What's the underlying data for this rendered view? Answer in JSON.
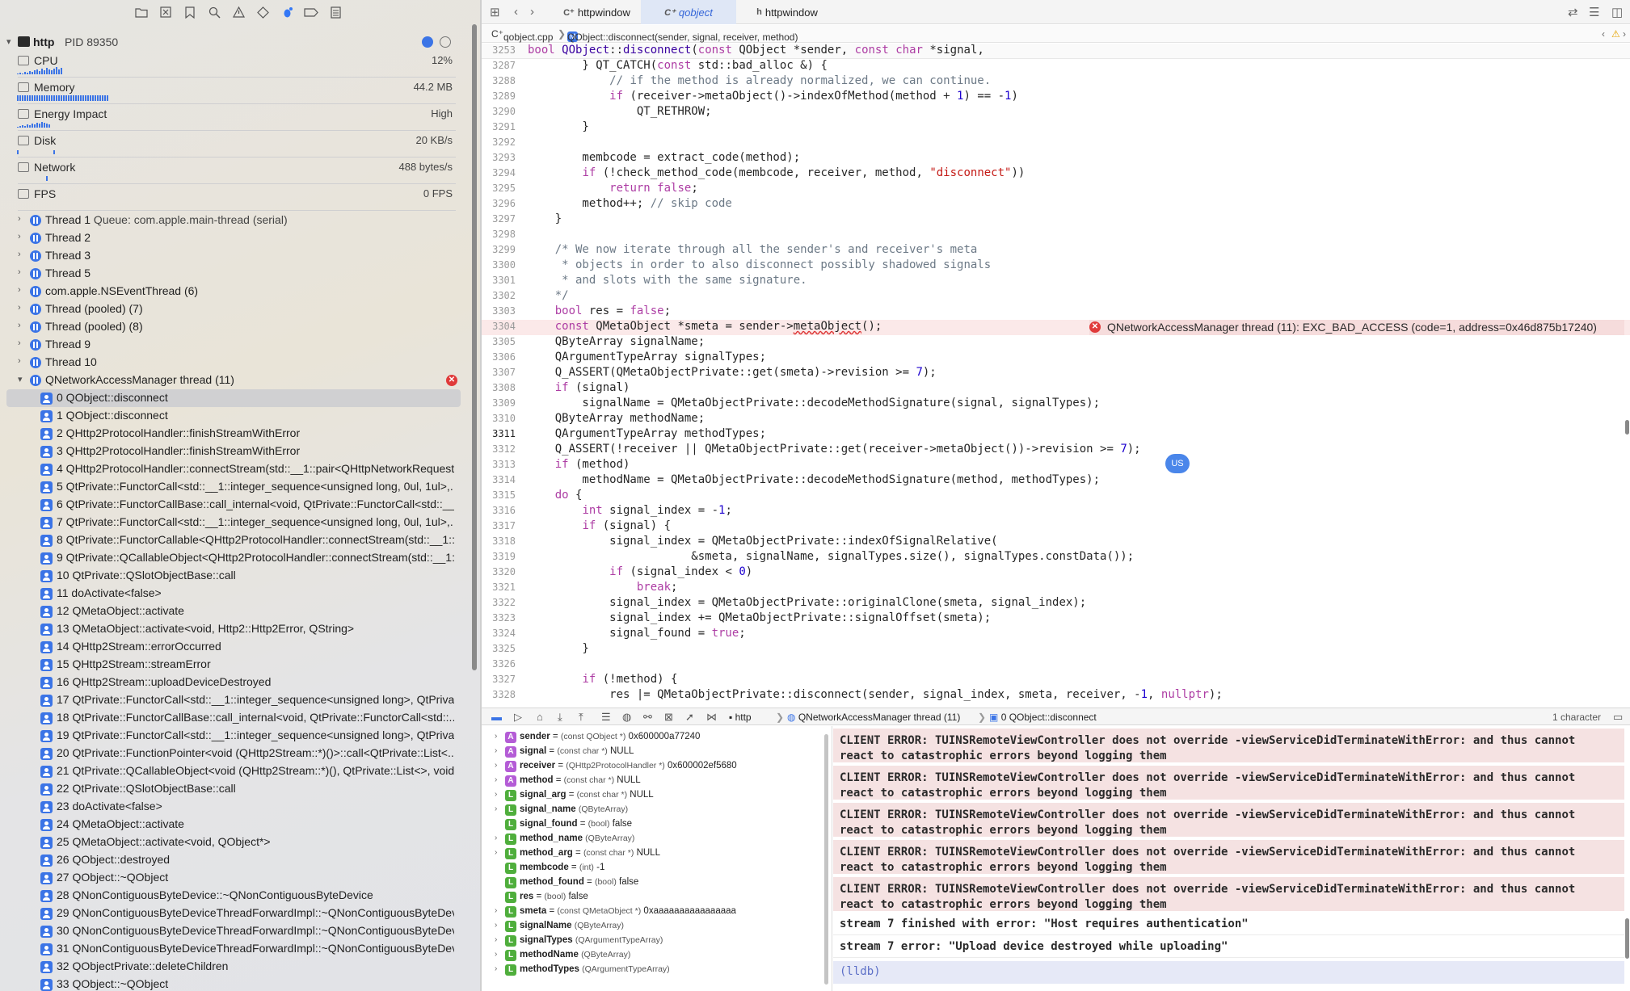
{
  "nav": {
    "toolbar_icons": [
      "folder-icon",
      "source-control-icon",
      "bookmark-icon",
      "find-icon",
      "issue-icon",
      "test-icon",
      "debug-icon",
      "breakpoint-icon",
      "report-icon"
    ]
  },
  "process": {
    "name": "http",
    "pid": "PID 89350"
  },
  "gauges": [
    {
      "name": "CPU",
      "value": "12%"
    },
    {
      "name": "Memory",
      "value": "44.2 MB"
    },
    {
      "name": "Energy Impact",
      "value": "High"
    },
    {
      "name": "Disk",
      "value": "20 KB/s"
    },
    {
      "name": "Network",
      "value": "488 bytes/s"
    },
    {
      "name": "FPS",
      "value": "0 FPS"
    }
  ],
  "threads": [
    {
      "label": "Thread 1",
      "queue": "Queue: com.apple.main-thread (serial)"
    },
    {
      "label": "Thread 2",
      "queue": ""
    },
    {
      "label": "Thread 3",
      "queue": ""
    },
    {
      "label": "Thread 5",
      "queue": ""
    },
    {
      "label": "com.apple.NSEventThread (6)",
      "queue": ""
    },
    {
      "label": "Thread (pooled) (7)",
      "queue": ""
    },
    {
      "label": "Thread (pooled) (8)",
      "queue": ""
    },
    {
      "label": "Thread 9",
      "queue": ""
    },
    {
      "label": "Thread 10",
      "queue": ""
    },
    {
      "label": "QNetworkAccessManager thread (11)",
      "queue": ""
    }
  ],
  "frames": [
    "0 QObject::disconnect",
    "1 QObject::disconnect",
    "2 QHttp2ProtocolHandler::finishStreamWithError",
    "3 QHttp2ProtocolHandler::finishStreamWithError",
    "4 QHttp2ProtocolHandler::connectStream(std::__1::pair<QHttpNetworkRequest...",
    "5 QtPrivate::FunctorCall<std::__1::integer_sequence<unsigned long, 0ul, 1ul>,...",
    "6 QtPrivate::FunctorCallBase::call_internal<void, QtPrivate::FunctorCall<std::__...",
    "7 QtPrivate::FunctorCall<std::__1::integer_sequence<unsigned long, 0ul, 1ul>,...",
    "8 QtPrivate::FunctorCallable<QHttp2ProtocolHandler::connectStream(std::__1::...",
    "9 QtPrivate::QCallableObject<QHttp2ProtocolHandler::connectStream(std::__1:...",
    "10 QtPrivate::QSlotObjectBase::call",
    "11 doActivate<false>",
    "12 QMetaObject::activate",
    "13 QMetaObject::activate<void, Http2::Http2Error, QString>",
    "14 QHttp2Stream::errorOccurred",
    "15 QHttp2Stream::streamError",
    "16 QHttp2Stream::uploadDeviceDestroyed",
    "17 QtPrivate::FunctorCall<std::__1::integer_sequence<unsigned long>, QtPrivat...",
    "18 QtPrivate::FunctorCallBase::call_internal<void, QtPrivate::FunctorCall<std::...",
    "19 QtPrivate::FunctorCall<std::__1::integer_sequence<unsigned long>, QtPrivat...",
    "20 QtPrivate::FunctionPointer<void (QHttp2Stream::*)()>::call<QtPrivate::List<...",
    "21 QtPrivate::QCallableObject<void (QHttp2Stream::*)(), QtPrivate::List<>, void...",
    "22 QtPrivate::QSlotObjectBase::call",
    "23 doActivate<false>",
    "24 QMetaObject::activate",
    "25 QMetaObject::activate<void, QObject*>",
    "26 QObject::destroyed",
    "27 QObject::~QObject",
    "28 QNonContiguousByteDevice::~QNonContiguousByteDevice",
    "29 QNonContiguousByteDeviceThreadForwardImpl::~QNonContiguousByteDev...",
    "30 QNonContiguousByteDeviceThreadForwardImpl::~QNonContiguousByteDev...",
    "31 QNonContiguousByteDeviceThreadForwardImpl::~QNonContiguousByteDevi...",
    "32 QObjectPrivate::deleteChildren",
    "33 QObject::~QObject"
  ],
  "tabs": [
    {
      "icon": "C⁺",
      "label": "httpwindow"
    },
    {
      "icon": "C⁺",
      "label": "qobject"
    },
    {
      "icon": "h",
      "label": "httpwindow"
    }
  ],
  "jumpbar": {
    "file": "qobject.cpp",
    "symbol": "QObject::disconnect(sender, signal, receiver, method)",
    "sep": "❯"
  },
  "code": {
    "sticky": {
      "num": "3253",
      "html": "<span class=\"k\">bool</span> <span class=\"t\">QObject</span>::<span class=\"t\">disconnect</span>(<span class=\"k\">const</span> QObject *sender, <span class=\"k\">const</span> <span class=\"k\">char</span> *signal,"
    },
    "lines": [
      {
        "num": "3287",
        "html": "        } QT_CATCH(<span class=\"k\">const</span> std::bad_alloc &amp;) {"
      },
      {
        "num": "3288",
        "html": "            <span class=\"c\">// if the method is already normalized, we can continue.</span>"
      },
      {
        "num": "3289",
        "html": "            <span class=\"k\">if</span> (receiver-&gt;metaObject()-&gt;indexOfMethod(method + <span class=\"n\">1</span>) == -<span class=\"n\">1</span>)"
      },
      {
        "num": "3290",
        "html": "                QT_RETHROW;"
      },
      {
        "num": "3291",
        "html": "        }"
      },
      {
        "num": "3292",
        "html": ""
      },
      {
        "num": "3293",
        "html": "        membcode = extract_code(method);"
      },
      {
        "num": "3294",
        "html": "        <span class=\"k\">if</span> (!check_method_code(membcode, receiver, method, <span class=\"s\">\"disconnect\"</span>))"
      },
      {
        "num": "3295",
        "html": "            <span class=\"k\">return</span> <span class=\"k\">false</span>;"
      },
      {
        "num": "3296",
        "html": "        method++; <span class=\"c\">// skip code</span>"
      },
      {
        "num": "3297",
        "html": "    }"
      },
      {
        "num": "3298",
        "html": ""
      },
      {
        "num": "3299",
        "html": "    <span class=\"c\">/* We now iterate through all the sender's and receiver's meta</span>"
      },
      {
        "num": "3300",
        "html": "<span class=\"c\">     * objects in order to also disconnect possibly shadowed signals</span>"
      },
      {
        "num": "3301",
        "html": "<span class=\"c\">     * and slots with the same signature.</span>"
      },
      {
        "num": "3302",
        "html": "<span class=\"c\">    */</span>"
      },
      {
        "num": "3303",
        "html": "    <span class=\"k\">bool</span> res = <span class=\"k\">false</span>;"
      },
      {
        "num": "3304",
        "html": "    <span class=\"k\">const</span> QMetaObject *smeta = sender-&gt;<span style=\"text-decoration: underline wavy #d33;\">metaObject</span>();",
        "error": true
      },
      {
        "num": "3305",
        "html": "    QByteArray signalName;"
      },
      {
        "num": "3306",
        "html": "    QArgumentTypeArray signalTypes;"
      },
      {
        "num": "3307",
        "html": "    Q_ASSERT(QMetaObjectPrivate::get(smeta)-&gt;revision &gt;= <span class=\"n\">7</span>);"
      },
      {
        "num": "3308",
        "html": "    <span class=\"k\">if</span> (signal)"
      },
      {
        "num": "3309",
        "html": "        signalName = QMetaObjectPrivate::decodeMethodSignature(signal, signalTypes);"
      },
      {
        "num": "3310",
        "html": "    QByteArray methodName;"
      },
      {
        "num": "3311",
        "html": "    QArgumentTypeArray methodTypes;",
        "current": true
      },
      {
        "num": "3312",
        "html": "    Q_ASSERT(!receiver || QMetaObjectPrivate::get(receiver-&gt;metaObject())-&gt;revision &gt;= <span class=\"n\">7</span>);"
      },
      {
        "num": "3313",
        "html": "    <span class=\"k\">if</span> (method)"
      },
      {
        "num": "3314",
        "html": "        methodName = QMetaObjectPrivate::decodeMethodSignature(method, methodTypes);"
      },
      {
        "num": "3315",
        "html": "    <span class=\"k\">do</span> {"
      },
      {
        "num": "3316",
        "html": "        <span class=\"k\">int</span> signal_index = -<span class=\"n\">1</span>;"
      },
      {
        "num": "3317",
        "html": "        <span class=\"k\">if</span> (signal) {"
      },
      {
        "num": "3318",
        "html": "            signal_index = QMetaObjectPrivate::indexOfSignalRelative("
      },
      {
        "num": "3319",
        "html": "                        &amp;smeta, signalName, signalTypes.size(), signalTypes.constData());"
      },
      {
        "num": "3320",
        "html": "            <span class=\"k\">if</span> (signal_index &lt; <span class=\"n\">0</span>)"
      },
      {
        "num": "3321",
        "html": "                <span class=\"k\">break</span>;"
      },
      {
        "num": "3322",
        "html": "            signal_index = QMetaObjectPrivate::originalClone(smeta, signal_index);"
      },
      {
        "num": "3323",
        "html": "            signal_index += QMetaObjectPrivate::signalOffset(smeta);"
      },
      {
        "num": "3324",
        "html": "            signal_found = <span class=\"k\">true</span>;"
      },
      {
        "num": "3325",
        "html": "        }"
      },
      {
        "num": "3326",
        "html": ""
      },
      {
        "num": "3327",
        "html": "        <span class=\"k\">if</span> (!method) {"
      },
      {
        "num": "3328",
        "html": "            res |= QMetaObjectPrivate::disconnect(sender, signal_index, smeta, receiver, -<span class=\"n\">1</span>, <span class=\"k\">nullptr</span>);"
      }
    ],
    "error_message": "QNetworkAccessManager thread (11): EXC_BAD_ACCESS (code=1, address=0x46d875b17240)",
    "bubble": "US"
  },
  "debugbar": {
    "process": "http",
    "thread": "QNetworkAccessManager thread (11)",
    "frame": "0 QObject::disconnect",
    "selection": "1 character"
  },
  "variables": [
    {
      "kind": "A",
      "expand": true,
      "name": "sender",
      "rest": " = ",
      "type": "(const QObject *)",
      "value": " 0x600000a77240"
    },
    {
      "kind": "A",
      "expand": true,
      "name": "signal",
      "rest": " = ",
      "type": "(const char *)",
      "value": " NULL"
    },
    {
      "kind": "A",
      "expand": true,
      "name": "receiver",
      "rest": " = ",
      "type": "(QHttp2ProtocolHandler *)",
      "value": " 0x600002ef5680"
    },
    {
      "kind": "A",
      "expand": true,
      "name": "method",
      "rest": " = ",
      "type": "(const char *)",
      "value": " NULL"
    },
    {
      "kind": "L",
      "expand": true,
      "name": "signal_arg",
      "rest": " = ",
      "type": "(const char *)",
      "value": " NULL"
    },
    {
      "kind": "L",
      "expand": true,
      "name": "signal_name",
      "rest": " ",
      "type": "(QByteArray)",
      "value": ""
    },
    {
      "kind": "L",
      "expand": false,
      "name": "signal_found",
      "rest": " = ",
      "type": "(bool)",
      "value": " false"
    },
    {
      "kind": "L",
      "expand": true,
      "name": "method_name",
      "rest": " ",
      "type": "(QByteArray)",
      "value": ""
    },
    {
      "kind": "L",
      "expand": true,
      "name": "method_arg",
      "rest": " = ",
      "type": "(const char *)",
      "value": " NULL"
    },
    {
      "kind": "L",
      "expand": false,
      "name": "membcode",
      "rest": " = ",
      "type": "(int)",
      "value": " -1"
    },
    {
      "kind": "L",
      "expand": false,
      "name": "method_found",
      "rest": " = ",
      "type": "(bool)",
      "value": " false"
    },
    {
      "kind": "L",
      "expand": false,
      "name": "res",
      "rest": " = ",
      "type": "(bool)",
      "value": " false"
    },
    {
      "kind": "L",
      "expand": true,
      "name": "smeta",
      "rest": " = ",
      "type": "(const QMetaObject *)",
      "value": " 0xaaaaaaaaaaaaaaaa"
    },
    {
      "kind": "L",
      "expand": true,
      "name": "signalName",
      "rest": " ",
      "type": "(QByteArray)",
      "value": ""
    },
    {
      "kind": "L",
      "expand": true,
      "name": "signalTypes",
      "rest": " ",
      "type": "(QArgumentTypeArray)",
      "value": ""
    },
    {
      "kind": "L",
      "expand": true,
      "name": "methodName",
      "rest": " ",
      "type": "(QByteArray)",
      "value": ""
    },
    {
      "kind": "L",
      "expand": true,
      "name": "methodTypes",
      "rest": " ",
      "type": "(QArgumentTypeArray)",
      "value": ""
    }
  ],
  "console": {
    "errors": [
      "CLIENT ERROR: TUINSRemoteViewController does not override -viewServiceDidTerminateWithError: and thus cannot\nreact to catastrophic errors beyond logging them",
      "CLIENT ERROR: TUINSRemoteViewController does not override -viewServiceDidTerminateWithError: and thus cannot\nreact to catastrophic errors beyond logging them",
      "CLIENT ERROR: TUINSRemoteViewController does not override -viewServiceDidTerminateWithError: and thus cannot\nreact to catastrophic errors beyond logging them",
      "CLIENT ERROR: TUINSRemoteViewController does not override -viewServiceDidTerminateWithError: and thus cannot\nreact to catastrophic errors beyond logging them",
      "CLIENT ERROR: TUINSRemoteViewController does not override -viewServiceDidTerminateWithError: and thus cannot\nreact to catastrophic errors beyond logging them"
    ],
    "lines": [
      "stream 7 finished with error: \"Host requires authentication\"",
      "stream 7 error: \"Upload device destroyed while uploading\""
    ],
    "prompt": "(lldb)"
  },
  "colors": {
    "accent": "#3b74e6",
    "error": "#e03a3a",
    "error_line": "#fbe9e9"
  }
}
